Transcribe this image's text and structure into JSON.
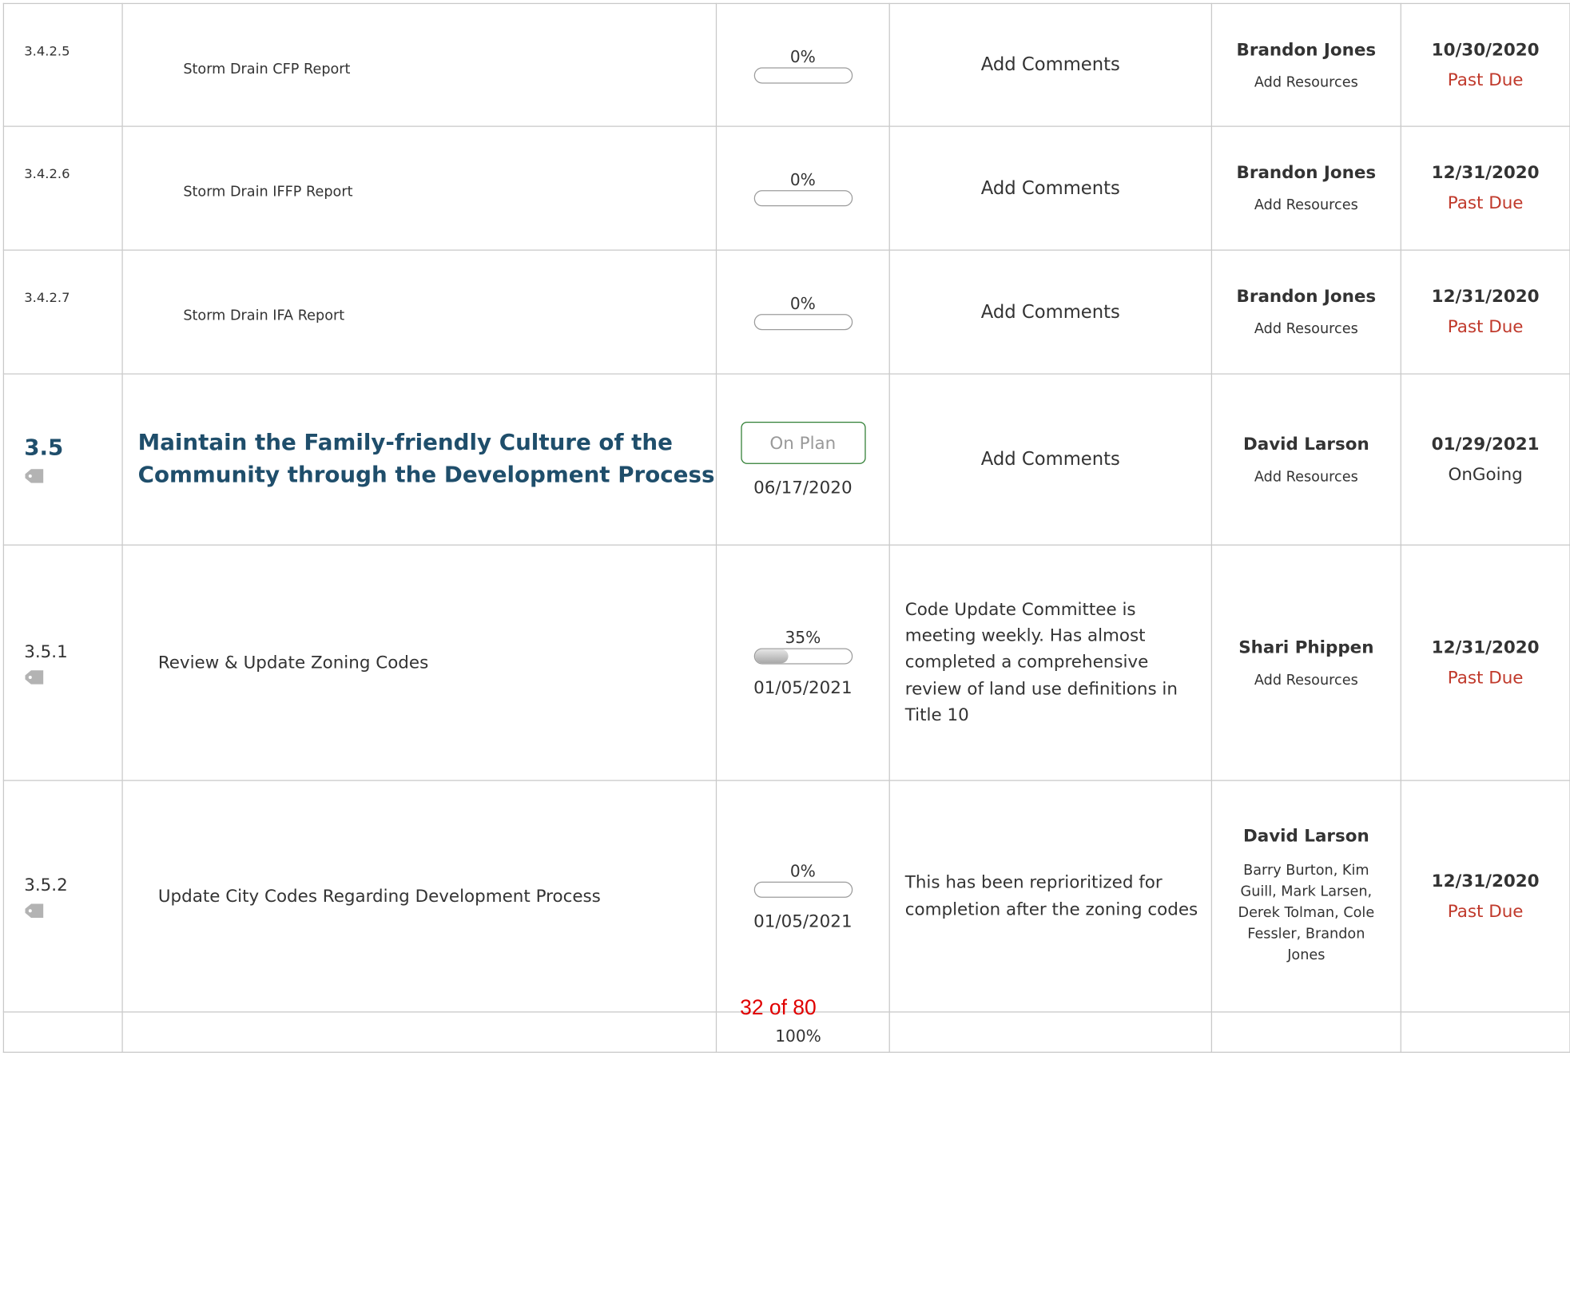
{
  "colors": {
    "heading": "#1f4e6b",
    "past_due": "#c0392b",
    "badge_border": "#2e7d32",
    "pager": "#e00000"
  },
  "rows": [
    {
      "num": "3.4.2.5",
      "title": "Storm Drain CFP Report",
      "progress_pct": "0%",
      "progress": 0,
      "comments": "Add Comments",
      "owner": "Brandon Jones",
      "resources": "Add Resources",
      "due_date": "10/30/2020",
      "due_status": "Past Due"
    },
    {
      "num": "3.4.2.6",
      "title": "Storm Drain IFFP Report",
      "progress_pct": "0%",
      "progress": 0,
      "comments": "Add Comments",
      "owner": "Brandon Jones",
      "resources": "Add Resources",
      "due_date": "12/31/2020",
      "due_status": "Past Due"
    },
    {
      "num": "3.4.2.7",
      "title": "Storm Drain IFA Report",
      "progress_pct": "0%",
      "progress": 0,
      "comments": "Add Comments",
      "owner": "Brandon Jones",
      "resources": "Add Resources",
      "due_date": "12/31/2020",
      "due_status": "Past Due"
    },
    {
      "num": "3.5",
      "title": "Maintain the Family-friendly Culture of the Community through the Development Process",
      "badge": "On Plan",
      "updated": "06/17/2020",
      "comments": "Add Comments",
      "owner": "David Larson",
      "resources": "Add Resources",
      "due_date": "01/29/2021",
      "due_status": "OnGoing"
    },
    {
      "num": "3.5.1",
      "title": "Review & Update Zoning Codes",
      "progress_pct": "35%",
      "progress": 0.35,
      "updated": "01/05/2021",
      "comments": "Code Update Committee is meeting weekly. Has almost completed a comprehensive review of land use definitions in Title 10",
      "owner": "Shari Phippen",
      "resources": "Add Resources",
      "due_date": "12/31/2020",
      "due_status": "Past Due"
    },
    {
      "num": "3.5.2",
      "title": "Update City Codes Regarding Development Process",
      "progress_pct": "0%",
      "progress": 0,
      "updated": "01/05/2021",
      "comments": "This has been reprioritized for completion after the zoning codes",
      "owner": "David Larson",
      "resources": "Barry Burton, Kim Guill, Mark Larsen, Derek Tolman, Cole Fessler, Brandon Jones",
      "due_date": "12/31/2020",
      "due_status": "Past Due"
    }
  ],
  "pager": "32 of 80",
  "cutoff_text": "100%"
}
